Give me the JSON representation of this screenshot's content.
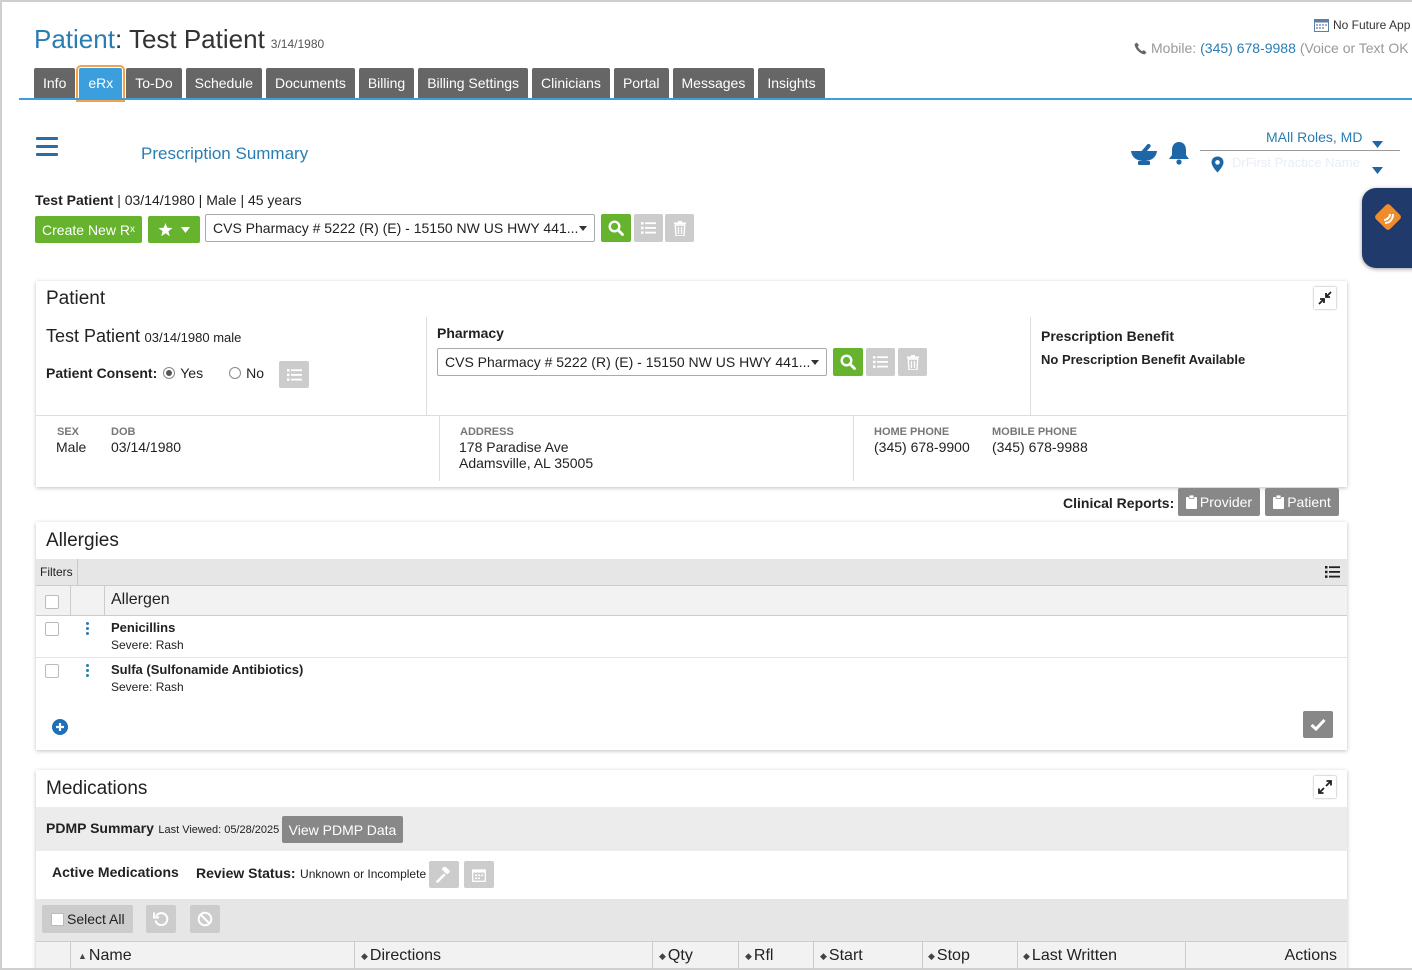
{
  "header": {
    "patient_label": "Patient",
    "patient_name": "Test Patient",
    "patient_dob": "3/14/1980",
    "future_appt": "No Future App",
    "mobile_label": "Mobile:",
    "mobile_number": "(345) 678-9988",
    "mobile_note": "(Voice or Text OK"
  },
  "tabs": [
    {
      "label": "Info",
      "active": false
    },
    {
      "label": "eRx",
      "active": true
    },
    {
      "label": "To-Do",
      "active": false
    },
    {
      "label": "Schedule",
      "active": false
    },
    {
      "label": "Documents",
      "active": false
    },
    {
      "label": "Billing",
      "active": false
    },
    {
      "label": "Billing Settings",
      "active": false
    },
    {
      "label": "Clinicians",
      "active": false
    },
    {
      "label": "Portal",
      "active": false
    },
    {
      "label": "Messages",
      "active": false
    },
    {
      "label": "Insights",
      "active": false
    }
  ],
  "toolbar": {
    "page_title": "Prescription Summary",
    "provider": "MAll Roles, MD",
    "location": "DrFirst Practice Name"
  },
  "demographics_line": {
    "name": "Test Patient",
    "details": " | 03/14/1980 | Male | 45 years"
  },
  "rx_bar": {
    "create_label": "Create New R",
    "create_sub": "x",
    "pharmacy": "CVS Pharmacy # 5222 (R) (E) - 15150 NW US HWY 441..."
  },
  "patient_card": {
    "title": "Patient",
    "name": "Test Patient",
    "name_details": "03/14/1980 male",
    "consent_label": "Patient Consent:",
    "consent_yes": "Yes",
    "consent_no": "No",
    "pharmacy_label": "Pharmacy",
    "pharmacy": "CVS Pharmacy # 5222 (R) (E) - 15150 NW US HWY 441...",
    "benefit_label": "Prescription Benefit",
    "benefit_value": "No Prescription Benefit Available",
    "sex_label": "SEX",
    "sex": "Male",
    "dob_label": "DOB",
    "dob": "03/14/1980",
    "address_label": "ADDRESS",
    "address_1": "178 Paradise Ave",
    "address_2": "Adamsville, AL 35005",
    "home_phone_label": "HOME PHONE",
    "home_phone": "(345) 678-9900",
    "mobile_phone_label": "MOBILE PHONE",
    "mobile_phone": "(345) 678-9988"
  },
  "clinical_reports": {
    "label": "Clinical Reports:",
    "provider": "Provider",
    "patient": "Patient"
  },
  "allergies": {
    "title": "Allergies",
    "filters": "Filters",
    "column": "Allergen",
    "rows": [
      {
        "name": "Penicillins",
        "detail": "Severe: Rash"
      },
      {
        "name": "Sulfa (Sulfonamide Antibiotics)",
        "detail": "Severe: Rash"
      }
    ]
  },
  "medications": {
    "title": "Medications",
    "pdmp_label": "PDMP Summary",
    "last_viewed": "Last Viewed: 05/28/2025",
    "view_pdmp": "View PDMP Data",
    "active_label": "Active Medications",
    "review_label": "Review Status:",
    "review_value": "Unknown or Incomplete",
    "select_all": "Select All",
    "columns": [
      "Name",
      "Directions",
      "Qty",
      "Rfl",
      "Start",
      "Stop",
      "Last Written",
      "Actions"
    ]
  }
}
